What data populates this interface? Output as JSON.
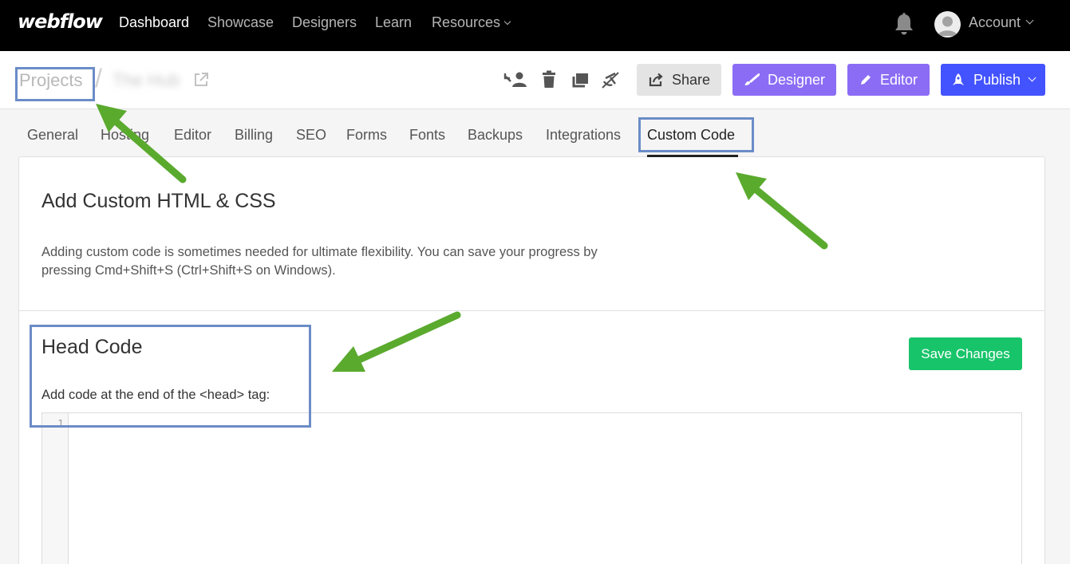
{
  "nav": {
    "logo": "webflow",
    "links": [
      "Dashboard",
      "Showcase",
      "Designers",
      "Learn",
      "Resources"
    ],
    "active": "Dashboard",
    "account_label": "Account",
    "icons": [
      "bell-icon",
      "avatar",
      "chevron-down-icon"
    ]
  },
  "project": {
    "breadcrumb_root": "Projects",
    "site_name": "The Hub",
    "toolbar_icons": [
      "transfer-user-icon",
      "trash-icon",
      "duplicate-icon",
      "archive-icon",
      "external-link-icon"
    ],
    "buttons": {
      "share": "Share",
      "designer": "Designer",
      "editor": "Editor",
      "publish": "Publish"
    }
  },
  "tabs": [
    "General",
    "Hosting",
    "Editor",
    "Billing",
    "SEO",
    "Forms",
    "Fonts",
    "Backups",
    "Integrations",
    "Custom Code"
  ],
  "active_tab": "Custom Code",
  "content": {
    "title": "Add Custom HTML & CSS",
    "description": "Adding custom code is sometimes needed for ultimate flexibility. You can save your progress by pressing Cmd+Shift+S (Ctrl+Shift+S on Windows).",
    "head_code": {
      "title": "Head Code",
      "subtitle": "Add code at the end of the <head> tag:",
      "save_label": "Save Changes",
      "line_number": "1"
    }
  },
  "colors": {
    "nav_bg": "#000000",
    "designer": "#8b6cf5",
    "publish": "#4353ff",
    "save": "#18c46a",
    "annotation_box": "#6b8cc7",
    "annotation_arrow": "#5aaa2e"
  }
}
